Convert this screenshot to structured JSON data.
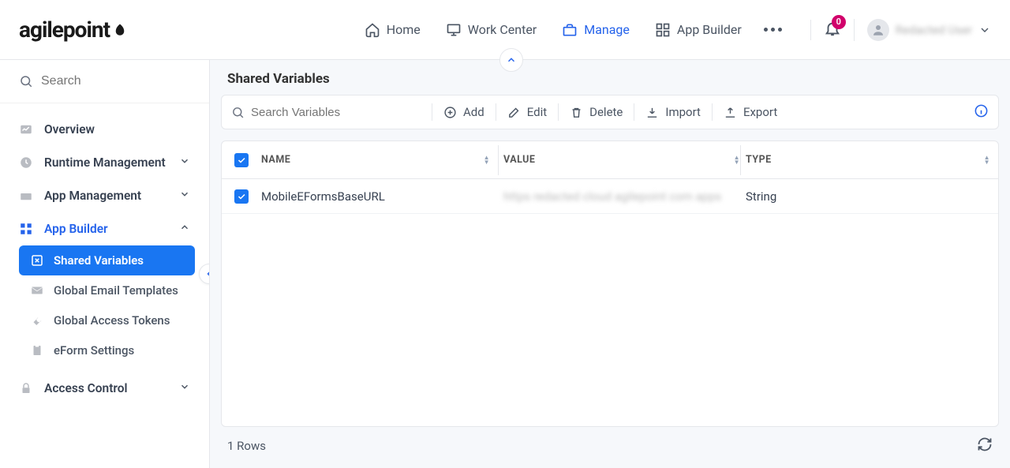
{
  "brand": {
    "name": "agilepoint"
  },
  "nav": {
    "home": "Home",
    "workcenter": "Work Center",
    "manage": "Manage",
    "appbuilder": "App Builder"
  },
  "notifications": {
    "count": "0"
  },
  "user": {
    "name": "Redacted User"
  },
  "sidebar": {
    "search_placeholder": "Search",
    "overview": "Overview",
    "runtime": "Runtime Management",
    "appmgmt": "App Management",
    "appbuilder": "App Builder",
    "shared_vars": "Shared Variables",
    "email_templates": "Global Email Templates",
    "access_tokens": "Global Access Tokens",
    "eform_settings": "eForm Settings",
    "access_control": "Access Control"
  },
  "main": {
    "title": "Shared Variables",
    "search_placeholder": "Search Variables",
    "add": "Add",
    "edit": "Edit",
    "delete": "Delete",
    "import": "Import",
    "export": "Export",
    "columns": {
      "name": "Name",
      "value": "Value",
      "type": "Type"
    },
    "rows": [
      {
        "name": "MobileEFormsBaseURL",
        "value": "https redacted cloud agilepoint com apps",
        "type": "String"
      }
    ],
    "row_count": "1 Rows"
  }
}
